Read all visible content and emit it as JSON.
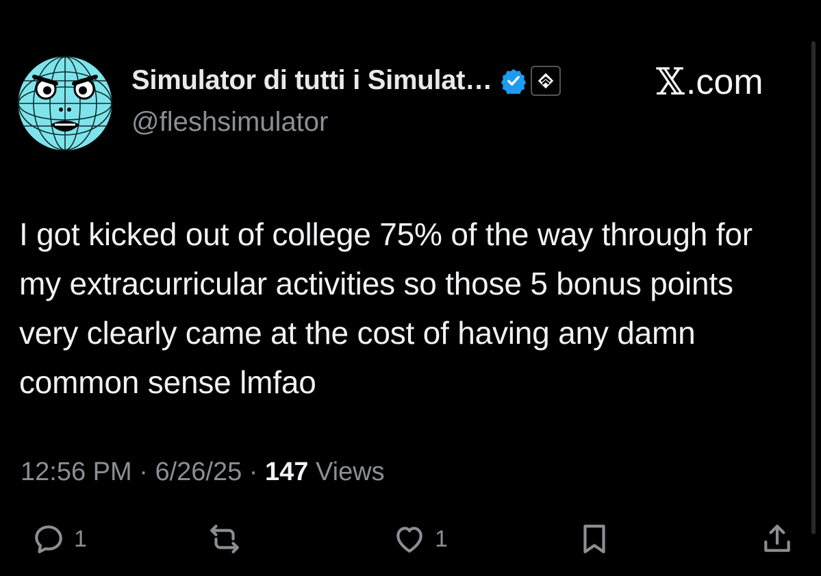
{
  "post": {
    "author": {
      "display_name": "Simulator di tutti i Simulat…",
      "handle": "@fleshsimulator",
      "avatar_icon": "globe-face-icon",
      "verified_icon": "verified-badge-icon",
      "affiliate_icon": "affiliate-badge-icon"
    },
    "brand": {
      "label": ".com",
      "glyph": "𝕏"
    },
    "text": "I got kicked out of college 75% of the way through for my extracurricular activities so those 5 bonus points very clearly came at the cost of having any damn common sense lmfao",
    "meta": {
      "time": "12:56 PM",
      "sep1": " · ",
      "date": "6/26/25",
      "sep2": " · ",
      "views_count": "147",
      "views_label": " Views"
    },
    "actions": {
      "reply": {
        "icon": "reply-icon",
        "count": "1"
      },
      "repost": {
        "icon": "repost-icon",
        "count": ""
      },
      "like": {
        "icon": "heart-icon",
        "count": "1"
      },
      "bookmark": {
        "icon": "bookmark-icon"
      },
      "share": {
        "icon": "share-icon"
      }
    }
  },
  "colors": {
    "background": "#000000",
    "text_primary": "#e7e9ea",
    "text_secondary": "#8b8f94",
    "verified_blue": "#1d9bf0",
    "avatar_cyan": "#7fe3ea"
  }
}
